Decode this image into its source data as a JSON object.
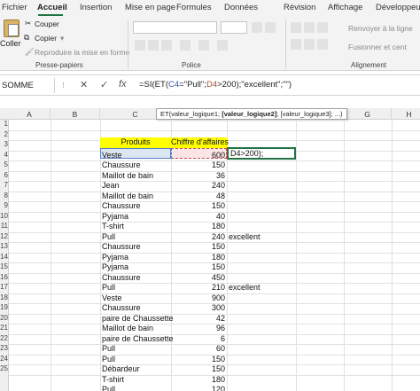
{
  "menu": {
    "items": [
      "Fichier",
      "Accueil",
      "Insertion",
      "Mise en page",
      "Formules",
      "Données",
      "Révision",
      "Affichage",
      "Développeur"
    ],
    "active": "Accueil"
  },
  "ribbon": {
    "clipboard": {
      "paste_label": "Coller",
      "cut_label": "Couper",
      "copy_label": "Copier",
      "format_painter_label": "Reproduire la mise en forme",
      "group_label": "Presse-papiers"
    },
    "font": {
      "group_label": "Police"
    },
    "alignment": {
      "wrap_label": "Renvoyer à la ligne",
      "merge_label": "Fusionner et cent",
      "group_label": "Alignement"
    }
  },
  "formula_bar": {
    "name_box": "SOMME",
    "cancel_icon": "close-icon",
    "enter_icon": "check-icon",
    "fx_label": "fx",
    "formula_parts": [
      "=SI(ET(",
      "C4",
      "=\"Pull\";",
      "D4",
      ">200);\"excellent\";\"\")"
    ]
  },
  "tooltip": {
    "before": "ET(valeur_logique1; ",
    "bold": "[valeur_logique2]",
    "after": "; [valeur_logique3]; ...)"
  },
  "columns": [
    "A",
    "B",
    "C",
    "D",
    "E",
    "F",
    "G",
    "H"
  ],
  "rows": [
    "1",
    "2",
    "3",
    "4",
    "5",
    "6",
    "7",
    "8",
    "9",
    "10",
    "11",
    "12",
    "13",
    "14",
    "15",
    "16",
    "17",
    "18",
    "19",
    "20",
    "21",
    "22",
    "23",
    "24",
    "25"
  ],
  "table": {
    "headers": {
      "product": "Produits",
      "revenue": "Chiffre d'affaires"
    },
    "editing_text": "D4>200);",
    "rows": [
      {
        "product": "Veste",
        "value": "600",
        "result": ""
      },
      {
        "product": "Chaussure",
        "value": "150",
        "result": ""
      },
      {
        "product": "Maillot de bain",
        "value": "36",
        "result": ""
      },
      {
        "product": "Jean",
        "value": "240",
        "result": ""
      },
      {
        "product": "Maillot de bain",
        "value": "48",
        "result": ""
      },
      {
        "product": "Chaussure",
        "value": "150",
        "result": ""
      },
      {
        "product": "Pyjama",
        "value": "40",
        "result": ""
      },
      {
        "product": "T-shirt",
        "value": "180",
        "result": ""
      },
      {
        "product": "Pull",
        "value": "240",
        "result": "excellent"
      },
      {
        "product": "Chaussure",
        "value": "150",
        "result": ""
      },
      {
        "product": "Pyjama",
        "value": "180",
        "result": ""
      },
      {
        "product": "Pyjama",
        "value": "150",
        "result": ""
      },
      {
        "product": "Chaussure",
        "value": "450",
        "result": ""
      },
      {
        "product": "Pull",
        "value": "210",
        "result": "excellent"
      },
      {
        "product": "Veste",
        "value": "900",
        "result": ""
      },
      {
        "product": "Chaussure",
        "value": "300",
        "result": ""
      },
      {
        "product": "paire de Chaussette",
        "value": "42",
        "result": ""
      },
      {
        "product": "Maillot de bain",
        "value": "96",
        "result": ""
      },
      {
        "product": "paire de Chaussette",
        "value": "6",
        "result": ""
      },
      {
        "product": "Pull",
        "value": "60",
        "result": ""
      },
      {
        "product": "Pull",
        "value": "150",
        "result": ""
      },
      {
        "product": "Débardeur",
        "value": "150",
        "result": ""
      },
      {
        "product": "T-shirt",
        "value": "180",
        "result": ""
      },
      {
        "product": "Pull",
        "value": "120",
        "result": ""
      },
      {
        "product": "Veste",
        "value": "300",
        "result": ""
      }
    ]
  },
  "colors": {
    "accent": "#217346",
    "header_yellow": "#ffff00",
    "ref_blue": "#3056c8",
    "ref_red": "#b7472a"
  }
}
